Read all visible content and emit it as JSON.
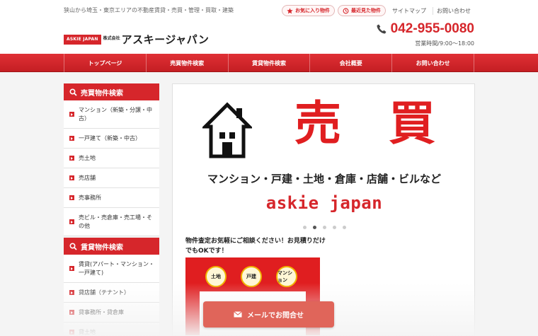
{
  "header": {
    "tagline": "狭山から埼玉・東京エリアの不動産賃貸・売買・管理・買取・建築",
    "logo_box": "ASKIE JAPAN",
    "logo_kabu": "株式会社",
    "logo_name": "アスキージャパン",
    "favorites_label": "お気に入り物件",
    "recent_label": "最近見た物件",
    "sitemap_label": "サイトマップ",
    "contact_label": "お問い合わせ",
    "phone": "042-955-0080",
    "hours": "営業時間/9:00～18:00"
  },
  "nav": {
    "items": [
      "トップページ",
      "売買物件検索",
      "賃貸物件検索",
      "会社概要",
      "お問い合わせ"
    ]
  },
  "sidebar": {
    "sale_head": "売買物件検索",
    "sale_items": [
      "マンション（新築・分譲・中古）",
      "一戸建て（新築・中古）",
      "売土地",
      "売店舗",
      "売事務所",
      "売ビル・売倉庫・売工場・その他"
    ],
    "rent_head": "賃貸物件検索",
    "rent_items": [
      "賃貸(アパート・マンション・一戸建て)",
      "貸店舗（テナント）",
      "貸事務所・貸倉庫",
      "貸土地"
    ]
  },
  "slide": {
    "char1": "売",
    "char2": "買",
    "subtitle": "マンション・戸建・土地・倉庫・店舗・ビルなど",
    "brand": "askie japan",
    "dots_total": 5,
    "dots_active": 2
  },
  "promo": {
    "text": "物件査定お気軽にご相談ください！お見積りだけでもOKです！",
    "badges": [
      "土地",
      "戸建",
      "マンション"
    ]
  },
  "mail_button": {
    "label": "メールでお問合せ"
  },
  "colors": {
    "accent": "#d6262b",
    "button": "#e0655a"
  }
}
